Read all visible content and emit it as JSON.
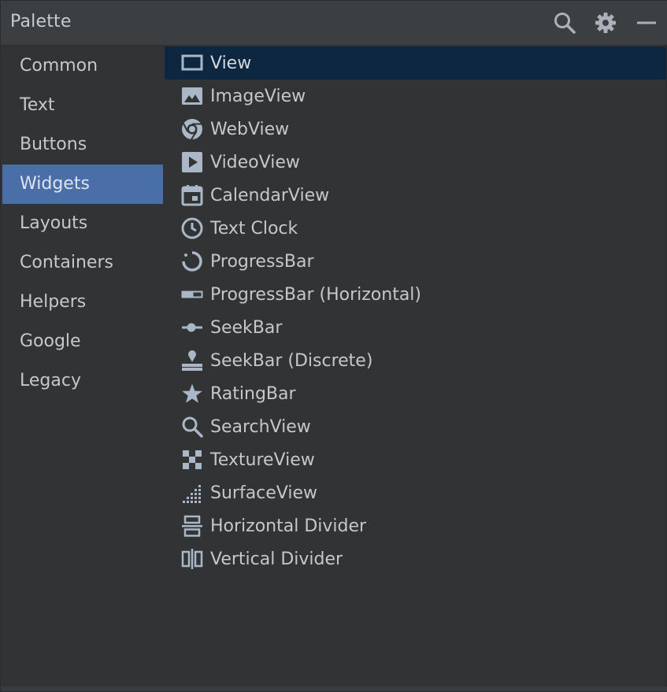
{
  "panel": {
    "title": "Palette",
    "actions": {
      "search_icon": "search-icon",
      "settings_icon": "gear-icon",
      "minimize_icon": "minimize-icon"
    }
  },
  "categories": [
    {
      "label": "Common"
    },
    {
      "label": "Text"
    },
    {
      "label": "Buttons"
    },
    {
      "label": "Widgets",
      "selected": true
    },
    {
      "label": "Layouts"
    },
    {
      "label": "Containers"
    },
    {
      "label": "Helpers"
    },
    {
      "label": "Google"
    },
    {
      "label": "Legacy"
    }
  ],
  "widgets": [
    {
      "label": "View",
      "icon": "view-icon",
      "selected": true
    },
    {
      "label": "ImageView",
      "icon": "image-icon"
    },
    {
      "label": "WebView",
      "icon": "web-icon"
    },
    {
      "label": "VideoView",
      "icon": "video-icon"
    },
    {
      "label": "CalendarView",
      "icon": "calendar-icon"
    },
    {
      "label": "Text Clock",
      "icon": "clock-icon"
    },
    {
      "label": "ProgressBar",
      "icon": "progress-circle-icon"
    },
    {
      "label": "ProgressBar (Horizontal)",
      "icon": "progress-horizontal-icon"
    },
    {
      "label": "SeekBar",
      "icon": "seekbar-icon"
    },
    {
      "label": "SeekBar (Discrete)",
      "icon": "seekbar-discrete-icon"
    },
    {
      "label": "RatingBar",
      "icon": "star-icon"
    },
    {
      "label": "SearchView",
      "icon": "search-icon"
    },
    {
      "label": "TextureView",
      "icon": "texture-icon"
    },
    {
      "label": "SurfaceView",
      "icon": "surface-icon"
    },
    {
      "label": "Horizontal Divider",
      "icon": "horizontal-divider-icon"
    },
    {
      "label": "Vertical Divider",
      "icon": "vertical-divider-icon"
    }
  ],
  "colors": {
    "background": "#313335",
    "header": "#3c3f41",
    "category_selected": "#4a6ea8",
    "widget_selected": "#0e2740",
    "text": "#c5c8cb",
    "icon": "#a9b7c6"
  }
}
